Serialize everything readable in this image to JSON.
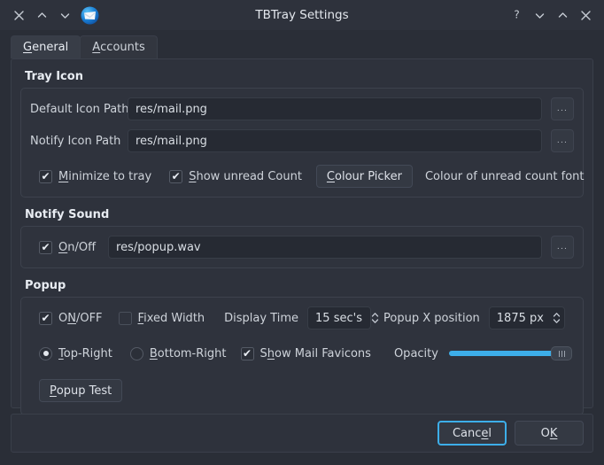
{
  "window": {
    "title": "TBTray Settings",
    "left_controls": [
      {
        "name": "close-icon",
        "glyph": "close"
      },
      {
        "name": "shade-up-icon",
        "glyph": "chevron-up"
      },
      {
        "name": "shade-down-icon",
        "glyph": "chevron-down"
      }
    ],
    "app_icon": "thunderbird-mail-icon",
    "right_controls": [
      {
        "name": "help-icon",
        "glyph": "question"
      },
      {
        "name": "minimize-icon",
        "glyph": "chevron-down"
      },
      {
        "name": "maximize-icon",
        "glyph": "chevron-up"
      },
      {
        "name": "close-icon",
        "glyph": "close"
      }
    ]
  },
  "tabs": [
    {
      "label": "General",
      "mnemonic": "G",
      "active": true
    },
    {
      "label": "Accounts",
      "mnemonic": "A",
      "active": false
    }
  ],
  "groups": {
    "tray_icon": {
      "title": "Tray Icon",
      "default_icon_path": {
        "label": "Default Icon Path",
        "value": "res/mail.png",
        "browse_label": "..."
      },
      "notify_icon_path": {
        "label": "Notify Icon Path",
        "value": "res/mail.png",
        "browse_label": "..."
      },
      "minimize_to_tray": {
        "label": "Minimize to tray",
        "mnemonic": "M",
        "checked": true,
        "check_glyph": "✔"
      },
      "show_unread_count": {
        "label": "Show unread Count",
        "mnemonic": "S",
        "checked": true,
        "check_glyph": "✔"
      },
      "colour_picker_button": {
        "label": "Colour Picker",
        "mnemonic": "C"
      },
      "colour_picker_hint": "Colour of unread count font"
    },
    "notify_sound": {
      "title": "Notify Sound",
      "on_off": {
        "label": "On/Off",
        "mnemonic": "O",
        "checked": true,
        "check_glyph": "✔"
      },
      "sound_path": {
        "value": "res/popup.wav",
        "browse_label": "..."
      }
    },
    "popup": {
      "title": "Popup",
      "on_off": {
        "label": "ON/OFF",
        "mnemonic": "N",
        "checked": true,
        "check_glyph": "✔"
      },
      "fixed_width": {
        "label": "Fixed Width",
        "mnemonic": "F",
        "checked": false,
        "check_glyph": ""
      },
      "display_time": {
        "label": "Display Time",
        "value": "15 sec's"
      },
      "popup_x_position": {
        "label": "Popup X position",
        "value": "1875 px"
      },
      "top_right": {
        "label": "Top-Right",
        "mnemonic": "T",
        "selected": true
      },
      "bottom_right": {
        "label": "Bottom-Right",
        "mnemonic": "B",
        "selected": false
      },
      "show_mail_favicons": {
        "label": "Show Mail Favicons",
        "mnemonic": "h",
        "checked": true,
        "check_glyph": "✔"
      },
      "opacity": {
        "label": "Opacity",
        "percent": 100,
        "accent_color": "#3daee9"
      },
      "popup_test_button": {
        "label": "Popup Test",
        "mnemonic": "P"
      }
    }
  },
  "dialog_buttons": {
    "cancel": {
      "label": "Cancel",
      "mnemonic": "e",
      "focused": true
    },
    "ok": {
      "label": "OK",
      "mnemonic": "K",
      "focused": false
    }
  }
}
